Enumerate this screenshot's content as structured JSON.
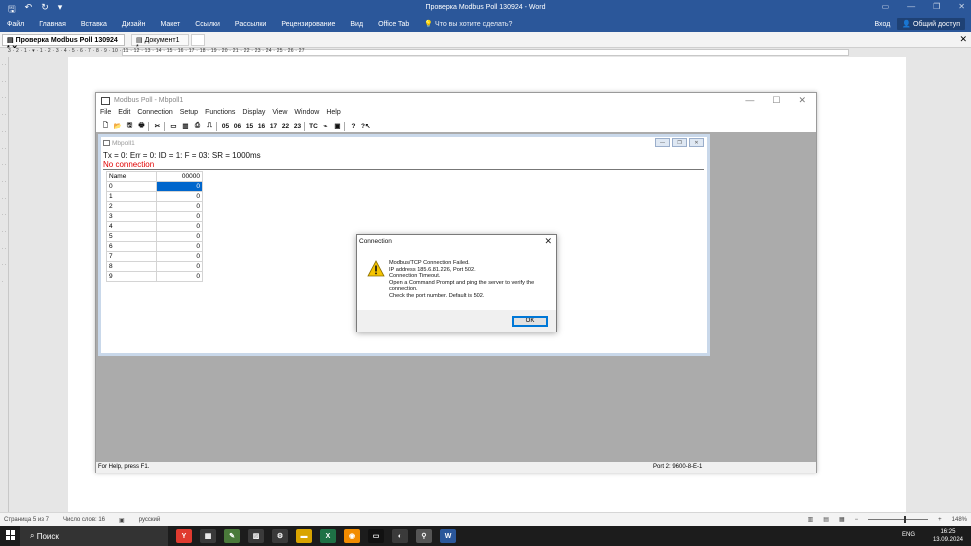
{
  "word": {
    "title": "Проверка Modbus Poll 130924 - Word",
    "ribbon_tabs": [
      "Файл",
      "Главная",
      "Вставка",
      "Дизайн",
      "Макет",
      "Ссылки",
      "Рассылки",
      "Рецензирование",
      "Вид",
      "Office Tab"
    ],
    "tell_me": "Что вы хотите сделать?",
    "sign_in": "Вход",
    "share": "Общий доступ",
    "doc_tabs": {
      "active": "Проверка Modbus Poll 130924 *",
      "other": "Документ1 *"
    },
    "ruler_numbers": "3 · 2 · 1 · ▾ · 1 · 2 · 3 · 4 · 5 · 6 · 7 · 8 · 9 · 10 · 11 · 12 · 13 · 14 · 15 · 16 · 17 · 18 · 19 · 20 · 21 · 22 · 23 · 24 · 25 · 26 · 27",
    "status": {
      "page": "Страница 5 из 7",
      "words": "Число слов: 16",
      "lang": "русский",
      "zoom": "148%"
    }
  },
  "taskbar": {
    "search": "Поиск",
    "lang": "ENG",
    "time": "16:25",
    "date": "13.09.2024"
  },
  "modbus": {
    "title": "Modbus Poll - Mbpoll1",
    "menu": [
      "File",
      "Edit",
      "Connection",
      "Setup",
      "Functions",
      "Display",
      "View",
      "Window",
      "Help"
    ],
    "toolbar_codes": [
      "05",
      "06",
      "15",
      "16",
      "17",
      "22",
      "23",
      "TC"
    ],
    "child": {
      "title": "Mbpoll1",
      "info": "Tx = 0: Err = 0: ID = 1: F = 03: SR = 1000ms",
      "connection": "No connection",
      "col_name": "Name",
      "col_addr": "00000",
      "rows": [
        {
          "idx": "0",
          "val": "0"
        },
        {
          "idx": "1",
          "val": "0"
        },
        {
          "idx": "2",
          "val": "0"
        },
        {
          "idx": "3",
          "val": "0"
        },
        {
          "idx": "4",
          "val": "0"
        },
        {
          "idx": "5",
          "val": "0"
        },
        {
          "idx": "6",
          "val": "0"
        },
        {
          "idx": "7",
          "val": "0"
        },
        {
          "idx": "8",
          "val": "0"
        },
        {
          "idx": "9",
          "val": "0"
        }
      ]
    },
    "status_left": "For Help, press F1.",
    "status_right": "Port 2: 9600-8-E-1"
  },
  "dialog": {
    "title": "Connection",
    "lines": [
      "Modbus/TCP Connection Failed.",
      "IP address 185.6.81.226, Port 502.",
      "Connection Timeout.",
      "Open a Command Prompt and ping the server to verify the",
      "connection.",
      "Check the port number. Default is 502."
    ],
    "ok": "OK"
  },
  "colors": {
    "word_blue": "#2b579a",
    "mdi_bg": "#ababab",
    "no_connection": "#e00000",
    "selection": "#0066cc"
  }
}
